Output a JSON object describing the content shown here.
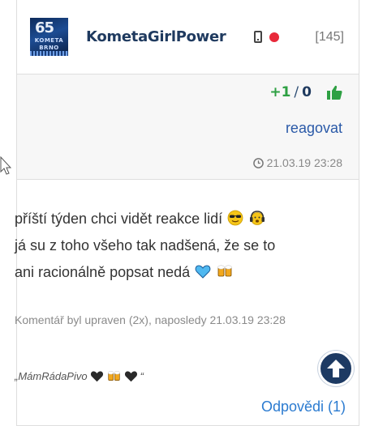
{
  "comment": {
    "author": {
      "username": "KometaGirlPower",
      "avatar_text": {
        "big": "65",
        "line1": "KOMETA",
        "line2": "BRNO"
      },
      "device_icon": "mobile-phone-icon",
      "status_color": "#e8293a"
    },
    "post_count": "[145]",
    "votes": {
      "plus": "+1",
      "separator": "/",
      "minus": "0",
      "icon": "thumbs-up-icon"
    },
    "react_label": "reagovat",
    "timestamp": "21.03.19 23:28",
    "text": {
      "line1": "příští týden chci vidět reakce lidí",
      "line2": "já su z toho všeho tak nadšená, že se to",
      "line3": "ani racionálně popsat nedá"
    },
    "edited_note": "Komentář byl upraven (2x), naposledy 21.03.19 23:28",
    "signature": {
      "open": "„MámRádaPivo",
      "close": "“"
    },
    "replies_label": "Odpovědi (1)"
  },
  "colors": {
    "accent": "#2b5aa8",
    "positive": "#2ea043",
    "link": "#2b7bd0",
    "dark_blue": "#1d3a63"
  }
}
